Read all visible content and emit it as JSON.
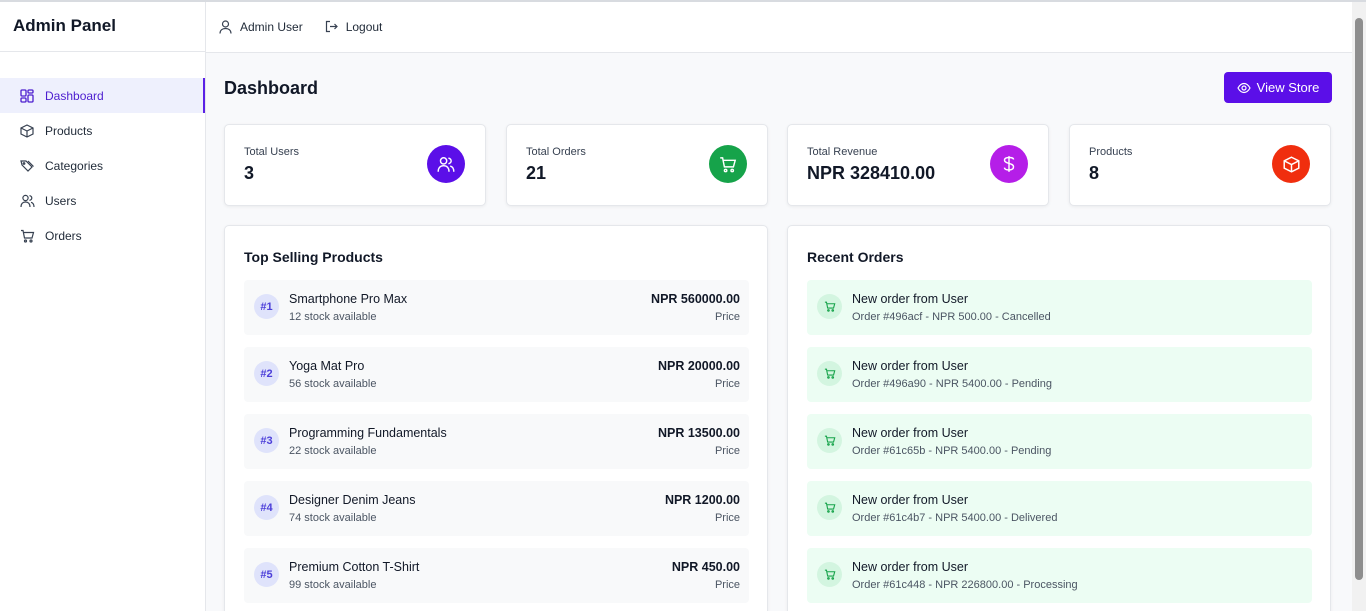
{
  "brand": "Admin Panel",
  "sidebar": {
    "items": [
      {
        "label": "Dashboard",
        "icon": "grid-icon",
        "active": true
      },
      {
        "label": "Products",
        "icon": "box-icon"
      },
      {
        "label": "Categories",
        "icon": "tag-icon"
      },
      {
        "label": "Users",
        "icon": "users-icon"
      },
      {
        "label": "Orders",
        "icon": "cart-icon"
      }
    ]
  },
  "topbar": {
    "user_label": "Admin User",
    "logout_label": "Logout"
  },
  "page": {
    "title": "Dashboard",
    "view_store_label": "View Store"
  },
  "stats": [
    {
      "label": "Total Users",
      "value": "3",
      "icon": "users-icon",
      "color": "#5b0fe8"
    },
    {
      "label": "Total Orders",
      "value": "21",
      "icon": "cart-icon",
      "color": "#16a34a"
    },
    {
      "label": "Total Revenue",
      "value": "NPR 328410.00",
      "icon": "dollar-icon",
      "color": "#b51ee8"
    },
    {
      "label": "Products",
      "value": "8",
      "icon": "box-icon",
      "color": "#f02e0e"
    }
  ],
  "top_selling": {
    "title": "Top Selling Products",
    "items": [
      {
        "rank": "#1",
        "name": "Smartphone Pro Max",
        "stock": "12 stock available",
        "price": "NPR 560000.00",
        "price_label": "Price"
      },
      {
        "rank": "#2",
        "name": "Yoga Mat Pro",
        "stock": "56 stock available",
        "price": "NPR 20000.00",
        "price_label": "Price"
      },
      {
        "rank": "#3",
        "name": "Programming Fundamentals",
        "stock": "22 stock available",
        "price": "NPR 13500.00",
        "price_label": "Price"
      },
      {
        "rank": "#4",
        "name": "Designer Denim Jeans",
        "stock": "74 stock available",
        "price": "NPR 1200.00",
        "price_label": "Price"
      },
      {
        "rank": "#5",
        "name": "Premium Cotton T-Shirt",
        "stock": "99 stock available",
        "price": "NPR 450.00",
        "price_label": "Price"
      }
    ]
  },
  "recent_orders": {
    "title": "Recent Orders",
    "items": [
      {
        "title": "New order from User",
        "detail": "Order #496acf - NPR 500.00 - Cancelled"
      },
      {
        "title": "New order from User",
        "detail": "Order #496a90 - NPR 5400.00 - Pending"
      },
      {
        "title": "New order from User",
        "detail": "Order #61c65b - NPR 5400.00 - Pending"
      },
      {
        "title": "New order from User",
        "detail": "Order #61c4b7 - NPR 5400.00 - Delivered"
      },
      {
        "title": "New order from User",
        "detail": "Order #61c448 - NPR 226800.00 - Processing"
      }
    ]
  }
}
